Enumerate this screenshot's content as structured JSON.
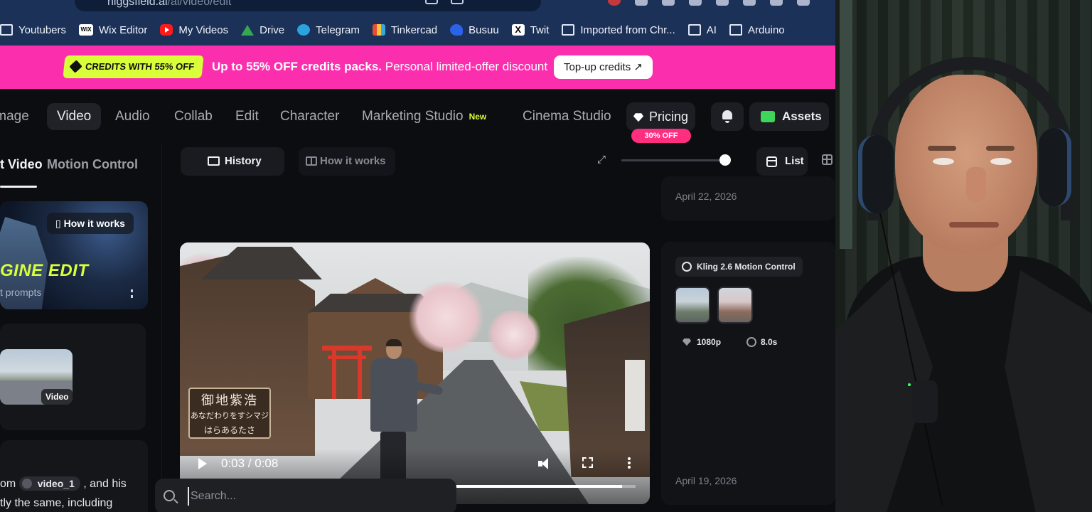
{
  "browser": {
    "url_host": "higgsfield.ai",
    "url_path": "/ai/video/edit",
    "bookmarks": [
      {
        "label": "Youtubers",
        "icon": "folder-icon"
      },
      {
        "label": "Wix Editor",
        "icon": "wix-icon"
      },
      {
        "label": "My Videos",
        "icon": "youtube-icon"
      },
      {
        "label": "Drive",
        "icon": "drive-icon"
      },
      {
        "label": "Telegram",
        "icon": "telegram-icon"
      },
      {
        "label": "Tinkercad",
        "icon": "tinkercad-icon"
      },
      {
        "label": "Busuu",
        "icon": "busuu-icon"
      },
      {
        "label": "Twit",
        "icon": "x-icon"
      },
      {
        "label": "Imported from Chr...",
        "icon": "folder-icon"
      },
      {
        "label": "AI",
        "icon": "folder-icon"
      },
      {
        "label": "Arduino",
        "icon": "folder-icon"
      }
    ]
  },
  "promo": {
    "badge": "CREDITS WITH 55% OFF",
    "headline": "Up to 55% OFF credits packs.",
    "subtext": "Personal limited-offer discount",
    "button": "Top-up credits ↗",
    "bg_color": "#fb2fae",
    "badge_color": "#d8ff3a"
  },
  "nav": {
    "items": [
      "Image",
      "Video",
      "Audio",
      "Collab",
      "Edit",
      "Character",
      "Marketing Studio",
      "Cinema Studio"
    ],
    "new_badge": "New",
    "pricing": "Pricing",
    "pricing_badge": "30% OFF",
    "assets": "Assets"
  },
  "left": {
    "tab_active": "t Video",
    "tab_inactive": "Motion Control",
    "card_how": "How it works",
    "card_title": "GINE EDIT",
    "card_sub": "t prompts",
    "upload_label": "Video",
    "prompt_line1_a": "om",
    "prompt_chip": "video_1",
    "prompt_line1_b": ", and his",
    "prompt_line2": "tly the same, including"
  },
  "center": {
    "history": "History",
    "how_it_works": "How it works",
    "list": "List",
    "zoom_level": 0.97,
    "video": {
      "sign_line1": "御地紫浩",
      "sign_line2": "あなだわりをすシマジ",
      "sign_line3": "はらあるたさ",
      "time": "0:03 / 0:08",
      "progress": 0.97
    },
    "search_placeholder": "Search..."
  },
  "history": {
    "date_top": "April 22, 2026",
    "model": "Kling 2.6 Motion Control",
    "resolution": "1080p",
    "duration": "8.0s",
    "date_bottom": "April 19, 2026"
  }
}
